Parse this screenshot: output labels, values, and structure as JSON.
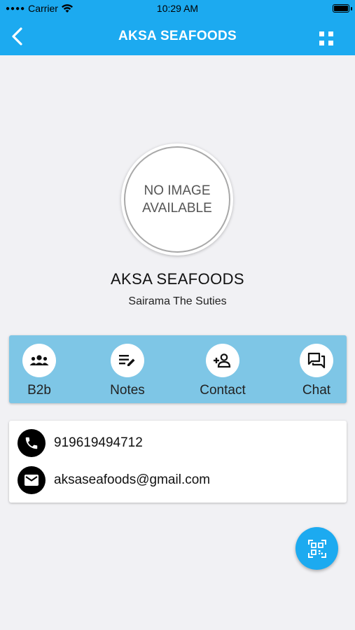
{
  "status_bar": {
    "carrier": "Carrier",
    "time": "10:29 AM"
  },
  "header": {
    "title": "AKSA SEAFOODS"
  },
  "profile": {
    "image_placeholder_line1": "NO IMAGE",
    "image_placeholder_line2": "AVAILABLE",
    "name": "AKSA SEAFOODS",
    "subtitle": "Sairama The Suties"
  },
  "actions": [
    {
      "label": "B2b",
      "icon": "group-icon"
    },
    {
      "label": "Notes",
      "icon": "notes-icon"
    },
    {
      "label": "Contact",
      "icon": "add-person-icon"
    },
    {
      "label": "Chat",
      "icon": "chat-icon"
    }
  ],
  "contact": {
    "phone": "919619494712",
    "email": "aksaseafoods@gmail.com"
  },
  "colors": {
    "primary": "#1caaf0",
    "action_bar": "#7ec6e6",
    "background": "#f1f1f4"
  }
}
